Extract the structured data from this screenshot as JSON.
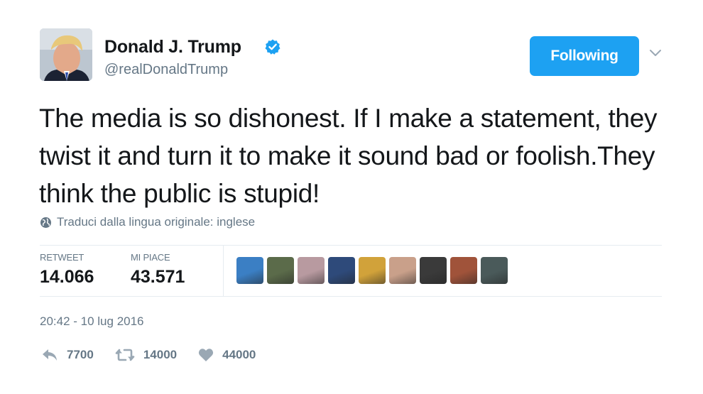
{
  "user": {
    "name": "Donald J. Trump",
    "handle": "@realDonaldTrump",
    "follow_label": "Following"
  },
  "tweet": {
    "text": "The media is so dishonest. If I make a statement, they twist it and turn it to make it sound bad or foolish.They think the public is stupid!",
    "translate_label": "Traduci dalla lingua originale: inglese"
  },
  "stats": {
    "retweets_label": "RETWEET",
    "retweets_value": "14.066",
    "likes_label": "MI PIACE",
    "likes_value": "43.571"
  },
  "timestamp": "20:42 - 10 lug 2016",
  "actions": {
    "reply_count": "7700",
    "retweet_count": "14000",
    "like_count": "44000"
  },
  "colors": {
    "accent": "#1da1f2",
    "muted": "#657786",
    "divider": "#e6ecf0"
  },
  "liker_avatars": [
    "#3b7fc4",
    "#5b6b4a",
    "#b89aa0",
    "#2e4a7a",
    "#d1a23a",
    "#c9a08a",
    "#3a3a3a",
    "#a0533a",
    "#4a5a5a"
  ]
}
